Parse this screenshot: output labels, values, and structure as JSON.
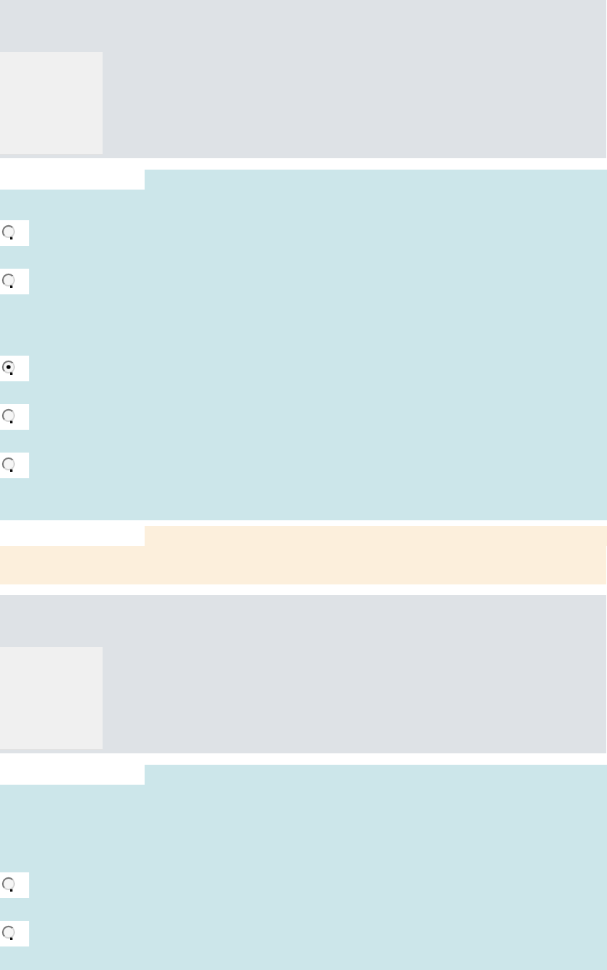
{
  "questions": [
    {
      "options": [
        {
          "selected": false
        },
        {
          "selected": false
        },
        {
          "selected": true
        },
        {
          "selected": false
        },
        {
          "selected": false
        }
      ],
      "feedback_shown": true
    },
    {
      "options": [
        {
          "selected": false
        },
        {
          "selected": false
        }
      ]
    }
  ]
}
